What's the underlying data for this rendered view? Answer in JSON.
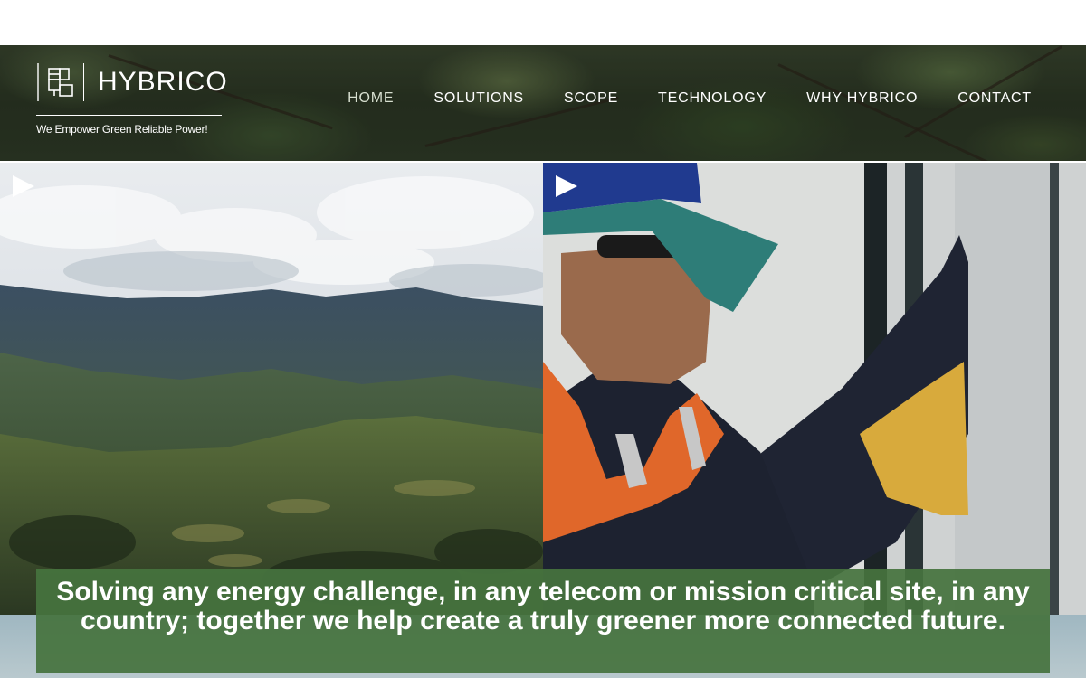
{
  "brand": {
    "name": "HYBRICO",
    "tagline": "We Empower Green Reliable Power!",
    "logo_icon": "hybrico-logo-icon"
  },
  "nav": {
    "items": [
      {
        "label": "HOME",
        "active": true
      },
      {
        "label": "SOLUTIONS",
        "active": false
      },
      {
        "label": "SCOPE",
        "active": false
      },
      {
        "label": "TECHNOLOGY",
        "active": false
      },
      {
        "label": "WHY HYBRICO",
        "active": false
      },
      {
        "label": "CONTACT",
        "active": false
      }
    ]
  },
  "hero": {
    "left_video": {
      "icon": "play-icon",
      "subject": "mountain-valley"
    },
    "right_video": {
      "icon": "play-icon",
      "subject": "technician"
    },
    "caption": "Solving any energy challenge, in any telecom or mission critical site, in any country; together we help create a truly greener more connected future."
  },
  "colors": {
    "caption_bg": "#46733e",
    "nav_text": "#ffffff",
    "nav_active": "#d7dfd0"
  }
}
